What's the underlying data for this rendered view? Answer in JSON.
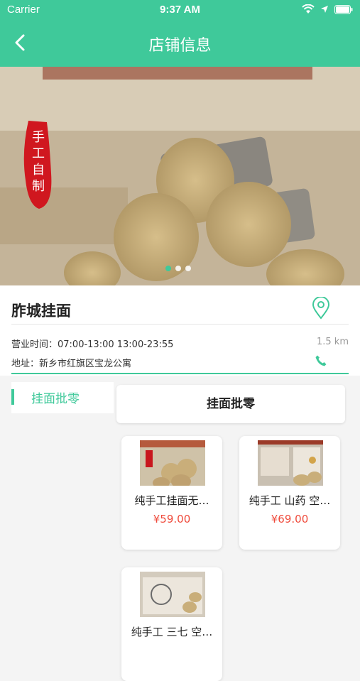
{
  "statusbar": {
    "carrier": "Carrier",
    "time": "9:37 AM"
  },
  "navbar": {
    "title": "店铺信息"
  },
  "banner": {
    "badge_text": "手工自制",
    "slides": 3,
    "active_slide": 1
  },
  "shop": {
    "name": "胙城挂面",
    "hours": "营业时间：07:00-13:00  13:00-23:55",
    "distance": "1.5 km",
    "address": "地址：新乡市红旗区宝龙公寓"
  },
  "sidebar": {
    "items": [
      {
        "label": "挂面批零"
      }
    ]
  },
  "category": {
    "title": "挂面批零"
  },
  "products": [
    {
      "name": "纯手工挂面无…",
      "price": "¥59.00"
    },
    {
      "name": "纯手工 山药 空…",
      "price": "¥69.00"
    },
    {
      "name": "纯手工 三七 空…",
      "price": ""
    }
  ],
  "colors": {
    "accent": "#3fc99a",
    "price": "#ef4a3b"
  }
}
